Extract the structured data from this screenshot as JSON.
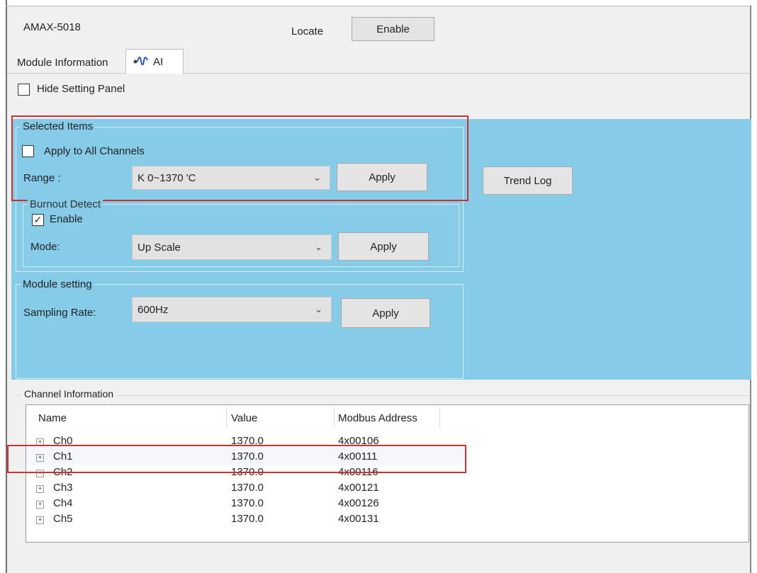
{
  "header": {
    "module_name": "AMAX-5018",
    "locate_label": "Locate",
    "enable_button": "Enable"
  },
  "tabs": [
    {
      "label": "Module Information",
      "active": false
    },
    {
      "label": "AI",
      "active": true,
      "icon": "wave-icon"
    }
  ],
  "hide_setting_panel": {
    "label": "Hide Setting Panel",
    "checked": false
  },
  "selected_items": {
    "title": "Selected Items",
    "apply_all": {
      "label": "Apply to All Channels",
      "checked": false
    },
    "range_label": "Range :",
    "range_value": "K 0~1370 'C",
    "apply_label": "Apply"
  },
  "trend_log_label": "Trend Log",
  "burnout": {
    "title": "Burnout Detect",
    "enable_label": "Enable",
    "enable_checked": true,
    "mode_label": "Mode:",
    "mode_value": "Up Scale",
    "apply_label": "Apply"
  },
  "module_setting": {
    "title": "Module setting",
    "sampling_label": "Sampling Rate:",
    "sampling_value": "600Hz",
    "apply_label": "Apply"
  },
  "channel_info": {
    "title": "Channel Information",
    "columns": [
      "Name",
      "Value",
      "Modbus Address"
    ],
    "rows": [
      {
        "name": "Ch0",
        "value": "1370.0",
        "address": "4x00106"
      },
      {
        "name": "Ch1",
        "value": "1370.0",
        "address": "4x00111"
      },
      {
        "name": "Ch2",
        "value": "1370.0",
        "address": "4x00116"
      },
      {
        "name": "Ch3",
        "value": "1370.0",
        "address": "4x00121"
      },
      {
        "name": "Ch4",
        "value": "1370.0",
        "address": "4x00126"
      },
      {
        "name": "Ch5",
        "value": "1370.0",
        "address": "4x00131"
      }
    ]
  },
  "colors": {
    "panel_blue": "#86cbe8",
    "highlight_red": "#d32f2f",
    "window_gray": "#f0f0f0"
  }
}
